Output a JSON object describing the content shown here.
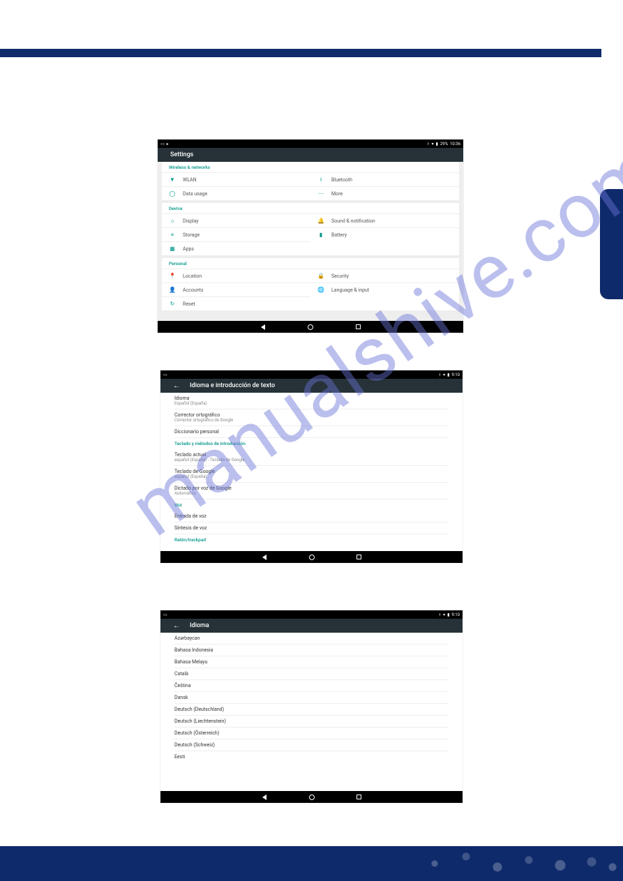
{
  "watermark": "manualshive.com",
  "shot1": {
    "status": {
      "time": "10:36",
      "battery": "29%"
    },
    "title": "Settings",
    "sections": [
      {
        "label": "Wireless & networks",
        "rows": [
          {
            "left": {
              "icon": "wifi",
              "label": "WLAN"
            },
            "right": {
              "icon": "bt",
              "label": "Bluetooth"
            }
          },
          {
            "left": {
              "icon": "data",
              "label": "Data usage"
            },
            "right": {
              "icon": "more",
              "label": "More"
            }
          }
        ]
      },
      {
        "label": "Device",
        "rows": [
          {
            "left": {
              "icon": "display",
              "label": "Display"
            },
            "right": {
              "icon": "sound",
              "label": "Sound & notification"
            }
          },
          {
            "left": {
              "icon": "storage",
              "label": "Storage"
            },
            "right": {
              "icon": "battery",
              "label": "Battery"
            }
          },
          {
            "left": {
              "icon": "apps",
              "label": "Apps"
            }
          }
        ]
      },
      {
        "label": "Personal",
        "rows": [
          {
            "left": {
              "icon": "location",
              "label": "Location"
            },
            "right": {
              "icon": "security",
              "label": "Security"
            }
          },
          {
            "left": {
              "icon": "accounts",
              "label": "Accounts"
            },
            "right": {
              "icon": "language",
              "label": "Language & input"
            }
          },
          {
            "left": {
              "icon": "reset",
              "label": "Reset"
            }
          }
        ]
      }
    ]
  },
  "shot2": {
    "status": {
      "time": "9:10"
    },
    "title": "Idioma e introducción de texto",
    "items": [
      {
        "title": "Idioma",
        "sub": "Español (España)"
      },
      {
        "title": "Corrector ortográfico",
        "sub": "Corrector ortográfico de Google"
      },
      {
        "title": "Diccionario personal"
      },
      {
        "header": true,
        "title": "Teclado y métodos de introducción"
      },
      {
        "title": "Teclado actual",
        "sub": "español (España) - Teclado de Google"
      },
      {
        "title": "Teclado de Google",
        "sub": "español (España)"
      },
      {
        "title": "Dictado por voz de Google",
        "sub": "Automático"
      },
      {
        "header": true,
        "title": "Voz"
      },
      {
        "title": "Entrada de voz"
      },
      {
        "title": "Síntesis de voz"
      },
      {
        "header": true,
        "title": "Ratón/trackpad"
      }
    ]
  },
  "shot3": {
    "status": {
      "time": "9:10"
    },
    "title": "Idioma",
    "items": [
      {
        "title": "Azərbaycan"
      },
      {
        "title": "Bahasa Indonesia"
      },
      {
        "title": "Bahasa Melayu"
      },
      {
        "title": "Català"
      },
      {
        "title": "Čeština"
      },
      {
        "title": "Dansk"
      },
      {
        "title": "Deutsch (Deutschland)"
      },
      {
        "title": "Deutsch (Liechtenstein)"
      },
      {
        "title": "Deutsch (Österreich)"
      },
      {
        "title": "Deutsch (Schweiz)"
      },
      {
        "title": "Eesti"
      }
    ]
  }
}
